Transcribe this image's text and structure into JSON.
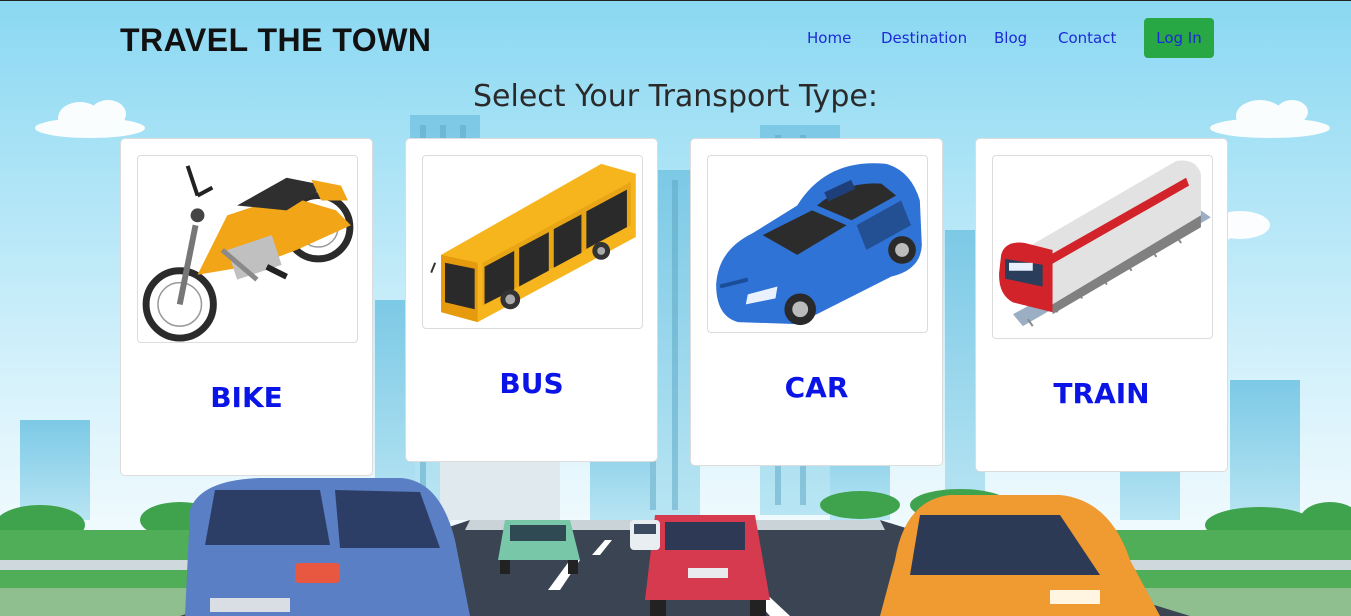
{
  "header": {
    "brand": "TRAVEL THE TOWN",
    "nav": [
      "Home",
      "Destination",
      "Blog",
      "Contact"
    ],
    "login_label": "Log In"
  },
  "main": {
    "heading": "Select Your Transport Type:",
    "cards": [
      {
        "label": "BIKE",
        "icon": "motorcycle-icon"
      },
      {
        "label": "BUS",
        "icon": "bus-icon"
      },
      {
        "label": "CAR",
        "icon": "car-icon"
      },
      {
        "label": "TRAIN",
        "icon": "train-icon"
      }
    ]
  },
  "colors": {
    "brand_text": "#111111",
    "nav_link": "#1d2ad6",
    "login_button": "#28a745",
    "card_label": "#0a14e6"
  }
}
